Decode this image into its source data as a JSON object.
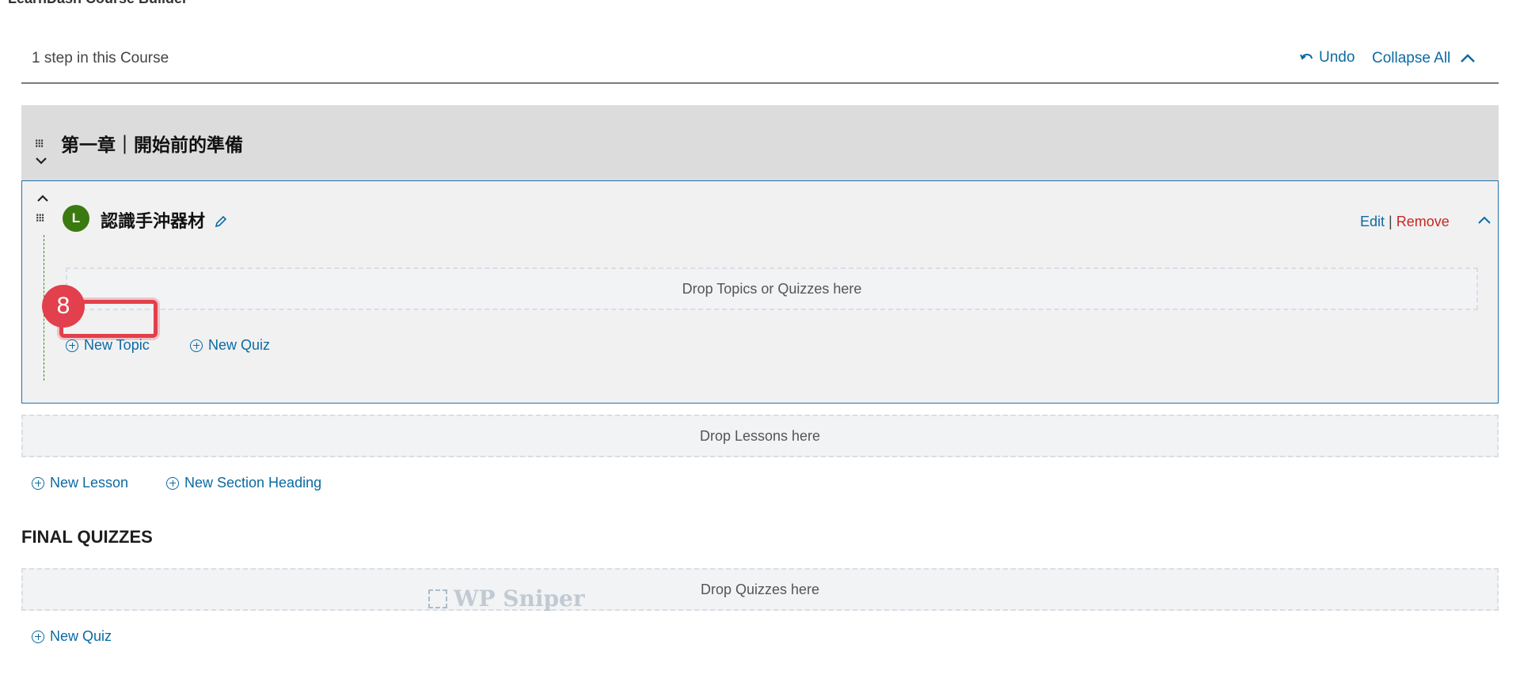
{
  "page": {
    "builder_title": "LearnDash Course Builder"
  },
  "header": {
    "steps_label": "1 step in this Course",
    "undo_label": "Undo",
    "collapse_all_label": "Collapse All"
  },
  "section": {
    "title": "第一章｜開始前的準備"
  },
  "lesson": {
    "badge": "L",
    "title": "認識手沖器材",
    "edit_label": "Edit",
    "separator": "|",
    "remove_label": "Remove",
    "drop_zone": "Drop Topics or Quizzes here",
    "new_topic_label": "New Topic",
    "new_quiz_label": "New Quiz"
  },
  "annotation": {
    "step_number": "8",
    "highlight_color": "#e1404c"
  },
  "lessons_area": {
    "drop_zone": "Drop Lessons here",
    "new_lesson_label": "New Lesson",
    "new_section_heading_label": "New Section Heading"
  },
  "final_quizzes": {
    "title": "FINAL QUIZZES",
    "drop_zone": "Drop Quizzes here",
    "new_quiz_label": "New Quiz"
  },
  "watermark": {
    "text": "WP Sniper"
  },
  "colors": {
    "link": "#0b6aa3",
    "remove": "#c7271f",
    "lesson_badge": "#3b7a10",
    "section_bar": "#dcdcdc",
    "lesson_border": "#2273a8"
  }
}
